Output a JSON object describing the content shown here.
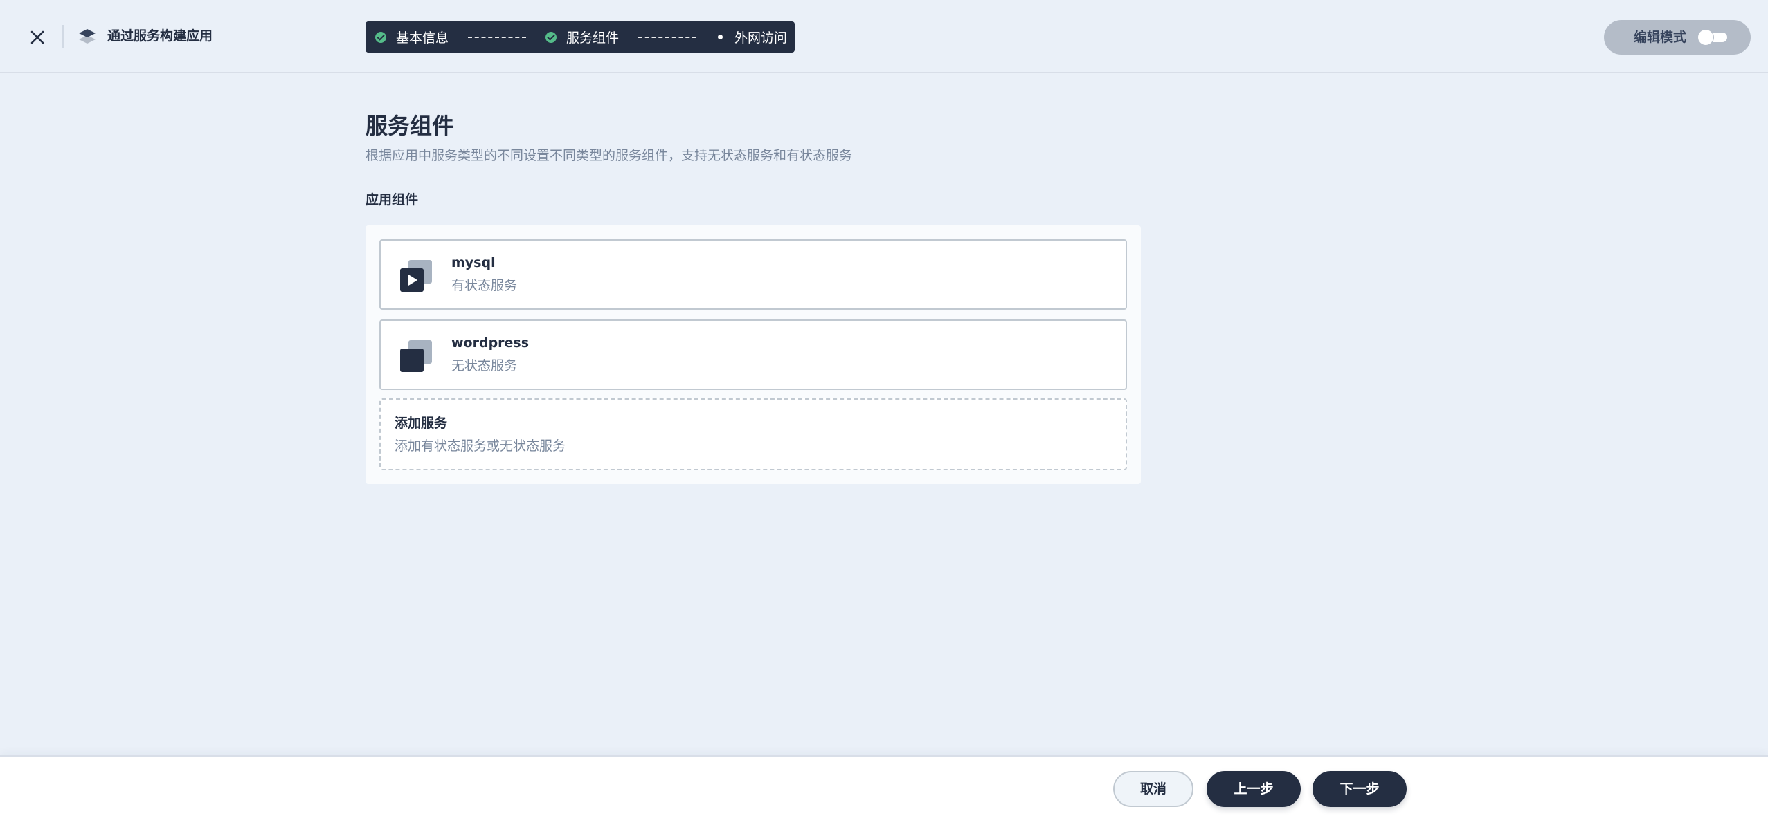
{
  "header": {
    "close_icon": "close-icon",
    "app_icon": "layers-icon",
    "title": "通过服务构建应用",
    "steps": [
      {
        "label": "基本信息",
        "state": "done"
      },
      {
        "label": "服务组件",
        "state": "done"
      },
      {
        "label": "外网访问",
        "state": "current"
      }
    ],
    "edit_mode": {
      "label": "编辑模式",
      "enabled": false
    }
  },
  "main": {
    "title": "服务组件",
    "description": "根据应用中服务类型的不同设置不同类型的服务组件，支持无状态服务和有状态服务",
    "section_title": "应用组件",
    "services": [
      {
        "name": "mysql",
        "type": "有状态服务",
        "icon": "stateful-service-icon"
      },
      {
        "name": "wordpress",
        "type": "无状态服务",
        "icon": "stateless-service-icon"
      }
    ],
    "add_service": {
      "title": "添加服务",
      "description": "添加有状态服务或无状态服务"
    }
  },
  "footer": {
    "cancel": "取消",
    "prev": "上一步",
    "next": "下一步"
  },
  "colors": {
    "background": "#eaf0f8",
    "dark": "#242e42",
    "success": "#55bc8a",
    "muted_text": "#79879c",
    "border": "#c1c9d1"
  }
}
